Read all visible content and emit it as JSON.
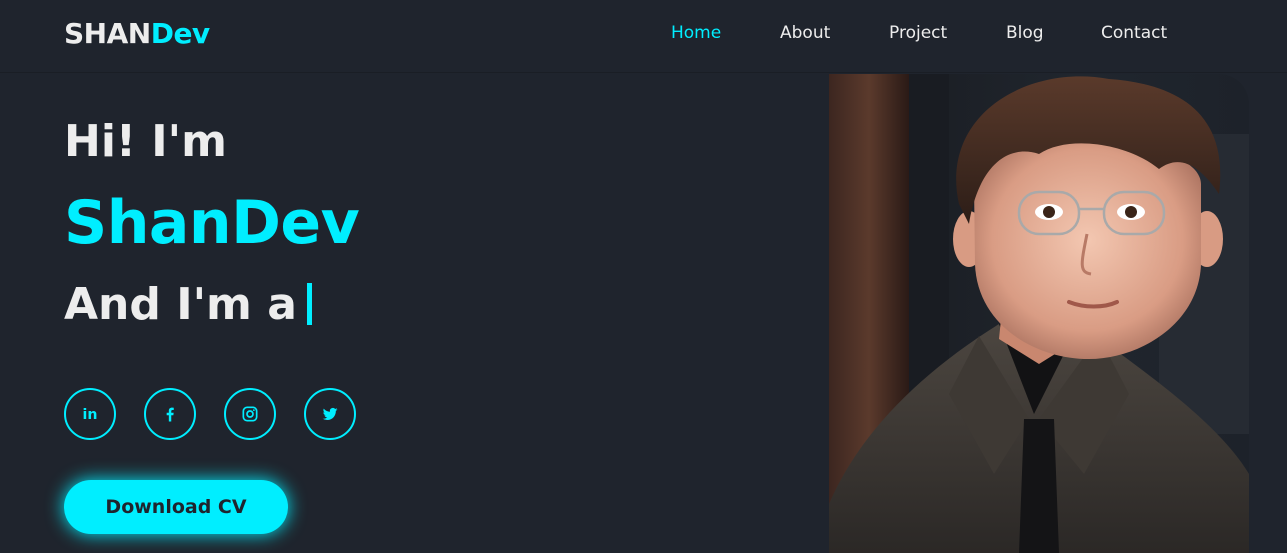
{
  "logo": {
    "part1": "SHAN",
    "part2": "Dev"
  },
  "nav": {
    "items": [
      {
        "label": "Home",
        "active": true
      },
      {
        "label": "About",
        "active": false
      },
      {
        "label": "Project",
        "active": false
      },
      {
        "label": "Blog",
        "active": false
      },
      {
        "label": "Contact",
        "active": false
      }
    ]
  },
  "hero": {
    "greeting": "Hi! I'm",
    "name": "ShanDev",
    "role_prefix": "And I'm a"
  },
  "social": [
    {
      "icon": "linkedin-icon",
      "glyph": "in"
    },
    {
      "icon": "facebook-icon",
      "glyph": "f"
    },
    {
      "icon": "instagram-icon",
      "glyph": ""
    },
    {
      "icon": "twitter-icon",
      "glyph": ""
    }
  ],
  "cta": {
    "label": "Download CV"
  },
  "colors": {
    "accent": "#00eeff",
    "background": "#1f242d",
    "text": "#ededed"
  }
}
